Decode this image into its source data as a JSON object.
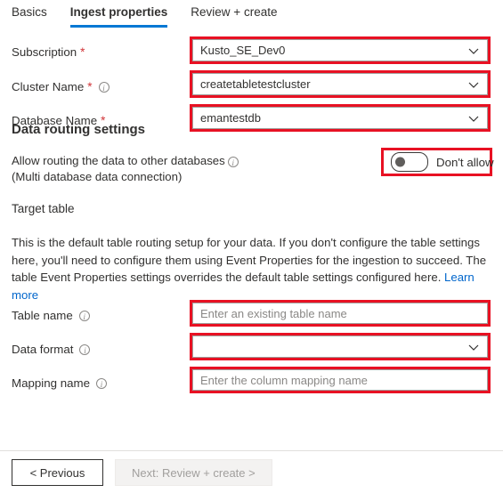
{
  "tabs": [
    {
      "label": "Basics",
      "active": false
    },
    {
      "label": "Ingest properties",
      "active": true
    },
    {
      "label": "Review + create",
      "active": false
    }
  ],
  "fields": {
    "subscription": {
      "label": "Subscription",
      "required": "*",
      "value": "Kusto_SE_Dev0"
    },
    "cluster_name": {
      "label": "Cluster Name",
      "required": "*",
      "value": "createtabletestcluster"
    },
    "database_name": {
      "label": "Database Name",
      "required": "*",
      "value": "emantestdb"
    },
    "table_name": {
      "label": "Table name",
      "placeholder": "Enter an existing table name",
      "value": ""
    },
    "data_format": {
      "label": "Data format",
      "value": ""
    },
    "mapping_name": {
      "label": "Mapping name",
      "placeholder": "Enter the column mapping name",
      "value": ""
    }
  },
  "data_routing": {
    "heading": "Data routing settings",
    "allow_label_line1": "Allow routing the data to other databases",
    "allow_label_line2": "(Multi database data connection)",
    "toggle_state_label": "Don't allow",
    "toggle_on": false
  },
  "target_table": {
    "heading": "Target table",
    "description_part1": "This is the default table routing setup for your data. If you don't configure the table settings here, you'll need to configure them using Event Properties for the ingestion to succeed. The table Event Properties settings overrides the default table settings configured here. ",
    "learn_more": "Learn more"
  },
  "footer": {
    "previous_label": "< Previous",
    "next_label": "Next: Review + create >"
  },
  "icons": {
    "info": "i",
    "chevron_down": "chevron-down-icon"
  },
  "colors": {
    "accent": "#0078d4",
    "annotation": "#e81123",
    "required": "#d13438",
    "link": "#0066cc"
  }
}
